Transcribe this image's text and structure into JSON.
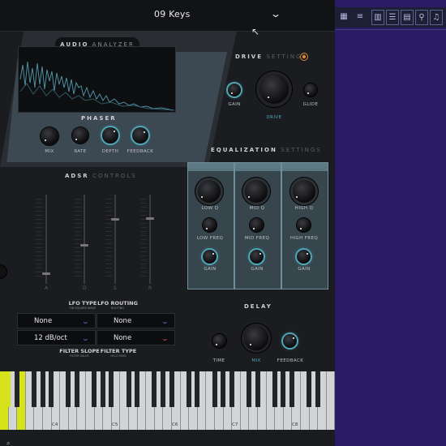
{
  "header": {
    "preset_name": "09 Keys"
  },
  "analyzer": {
    "title_bold": "AUDIO",
    "title_light": "ANALYZER"
  },
  "phaser": {
    "title": "PHASER",
    "knobs": [
      "MIX",
      "RATE",
      "DEPTH",
      "FEEDBACK"
    ]
  },
  "drive": {
    "title_bold": "DRIVE",
    "title_light": "SETTINGS",
    "knobs": [
      "GAIN",
      "DRIVE",
      "GLIDE"
    ]
  },
  "eq": {
    "title_bold": "EQUALIZATION",
    "title_light": "SETTINGS",
    "bands": [
      {
        "q": "LOW Q",
        "freq": "LOW FREQ",
        "gain": "GAIN"
      },
      {
        "q": "MID Q",
        "freq": "MID FREQ",
        "gain": "GAIN"
      },
      {
        "q": "HIGH Q",
        "freq": "HIGH FREQ",
        "gain": "GAIN"
      }
    ]
  },
  "adsr": {
    "title_bold": "ADSR",
    "title_light": "CONTROLS",
    "labels": [
      "A",
      "D",
      "S",
      "R"
    ]
  },
  "lfo": {
    "type_label": "LFO TYPE",
    "type_sub": "ON SQUARE WAVE",
    "routing_label": "LFO ROUTING",
    "routing_sub": "ROUTING",
    "filter_slope_label": "FILTER SLOPE",
    "filter_slope_sub": "FILTER VALUE",
    "filter_type_label": "FILTER TYPE",
    "filter_type_sub": "HI-LO PASS",
    "dropdowns": [
      "None",
      "None",
      "12 dB/oct",
      "None"
    ]
  },
  "delay": {
    "title": "DELAY",
    "knobs": [
      "TIME",
      "MIX",
      "FEEDBACK"
    ]
  },
  "keyboard": {
    "octaves": [
      "C4",
      "C5",
      "C6",
      "C7",
      "C8"
    ]
  },
  "colors": {
    "accent_teal": "#4fa7b8",
    "accent_orange": "#e08a2e",
    "key_highlight": "#d6e21a",
    "host_bg": "#2b1a66"
  },
  "icons": {
    "dropdown": "chevron-down-icon",
    "cursor": "mouse-cursor-icon",
    "drive_power": "power-icon",
    "search": "search-icon"
  }
}
